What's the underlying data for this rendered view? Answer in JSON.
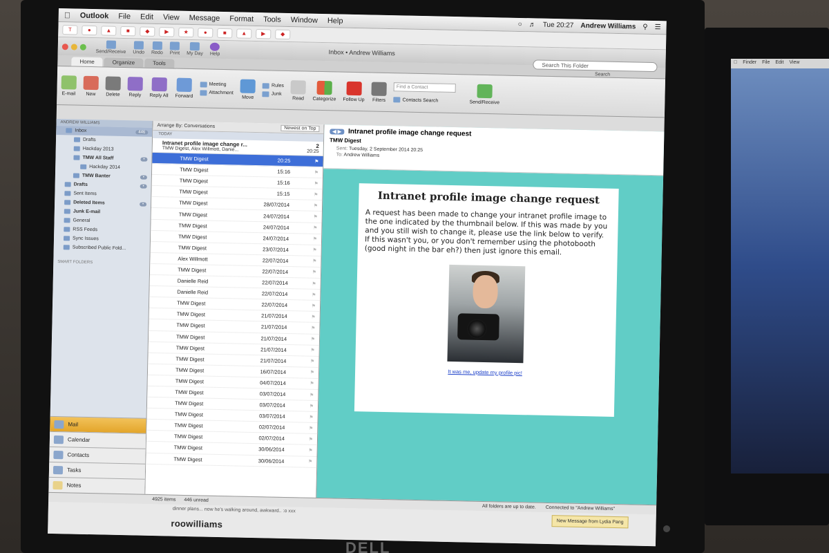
{
  "menubar": {
    "app_name": "Outlook",
    "menus": [
      "File",
      "Edit",
      "View",
      "Message",
      "Format",
      "Tools",
      "Window",
      "Help"
    ],
    "clock": "Tue 20:27",
    "user": "Andrew Williams"
  },
  "window": {
    "title": "Inbox • Andrew Williams",
    "quick_tools": [
      "Send/Receive",
      "Undo",
      "Redo",
      "Print",
      "My Day",
      "Help"
    ]
  },
  "tabs": [
    "Home",
    "Organize",
    "Tools"
  ],
  "search": {
    "placeholder": "Search This Folder",
    "caption": "Search"
  },
  "ribbon": {
    "buttons": [
      "E-mail",
      "New",
      "Delete",
      "Reply",
      "Reply All",
      "Forward"
    ],
    "small_buttons": [
      "Meeting",
      "Attachment"
    ],
    "move_label": "Move",
    "rules_label": "Rules",
    "junk_label": "Junk",
    "read_label": "Read",
    "categorize_label": "Categorize",
    "followup_label": "Follow Up",
    "filters_label": "Filters",
    "find_contact_placeholder": "Find a Contact",
    "contacts_search_label": "Contacts Search",
    "send_receive_label": "Send/Receive"
  },
  "sidebar": {
    "account": "ANDREW WILLIAMS",
    "folders": [
      {
        "label": "Inbox",
        "badge": "446",
        "level": 0,
        "selected": true
      },
      {
        "label": "Drafts",
        "badge": "",
        "level": 1,
        "selected": false
      },
      {
        "label": "Hackday 2013",
        "badge": "",
        "level": 1,
        "selected": false
      },
      {
        "label": "TMW All Staff",
        "badge": "",
        "level": 1,
        "selected": false
      },
      {
        "label": "Hackday 2014",
        "badge": "",
        "level": 2,
        "selected": false
      },
      {
        "label": "TMW Banter",
        "badge": "",
        "level": 1,
        "selected": false
      },
      {
        "label": "Drafts",
        "badge": "",
        "level": 0,
        "selected": false
      },
      {
        "label": "Sent Items",
        "badge": "",
        "level": 0,
        "selected": false
      },
      {
        "label": "Deleted Items",
        "badge": "",
        "level": 0,
        "selected": false
      },
      {
        "label": "Junk E-mail",
        "badge": "",
        "level": 0,
        "selected": false
      },
      {
        "label": "General",
        "badge": "",
        "level": 0,
        "selected": false
      },
      {
        "label": "RSS Feeds",
        "badge": "",
        "level": 0,
        "selected": false
      },
      {
        "label": "Sync Issues",
        "badge": "",
        "level": 0,
        "selected": false
      },
      {
        "label": "Subscribed Public Fold...",
        "badge": "",
        "level": 0,
        "selected": false
      }
    ],
    "smart_folders": "SMART FOLDERS",
    "nav": [
      {
        "label": "Mail",
        "selected": true
      },
      {
        "label": "Calendar",
        "selected": false
      },
      {
        "label": "Contacts",
        "selected": false
      },
      {
        "label": "Tasks",
        "selected": false
      },
      {
        "label": "Notes",
        "selected": false
      }
    ]
  },
  "message_list": {
    "arrange_by": "Arrange By: Conversations",
    "sort": "Newest on Top",
    "group": "TODAY",
    "conversation": {
      "subject": "Intranet profile image change r...",
      "count": "2",
      "participants": "TMW Digest, Alex Willmott, Danie...",
      "time": "20:25"
    },
    "rows": [
      {
        "from": "TMW Digest",
        "date": "20:25",
        "selected": true
      },
      {
        "from": "TMW Digest",
        "date": "15:16",
        "selected": false
      },
      {
        "from": "TMW Digest",
        "date": "15:16",
        "selected": false
      },
      {
        "from": "TMW Digest",
        "date": "15:15",
        "selected": false
      },
      {
        "from": "TMW Digest",
        "date": "28/07/2014",
        "selected": false
      },
      {
        "from": "TMW Digest",
        "date": "24/07/2014",
        "selected": false
      },
      {
        "from": "TMW Digest",
        "date": "24/07/2014",
        "selected": false
      },
      {
        "from": "TMW Digest",
        "date": "24/07/2014",
        "selected": false
      },
      {
        "from": "TMW Digest",
        "date": "23/07/2014",
        "selected": false
      },
      {
        "from": "Alex Willmott",
        "date": "22/07/2014",
        "selected": false
      },
      {
        "from": "TMW Digest",
        "date": "22/07/2014",
        "selected": false
      },
      {
        "from": "Danielle Reid",
        "date": "22/07/2014",
        "selected": false
      },
      {
        "from": "Danielle Reid",
        "date": "22/07/2014",
        "selected": false
      },
      {
        "from": "TMW Digest",
        "date": "22/07/2014",
        "selected": false
      },
      {
        "from": "TMW Digest",
        "date": "21/07/2014",
        "selected": false
      },
      {
        "from": "TMW Digest",
        "date": "21/07/2014",
        "selected": false
      },
      {
        "from": "TMW Digest",
        "date": "21/07/2014",
        "selected": false
      },
      {
        "from": "TMW Digest",
        "date": "21/07/2014",
        "selected": false
      },
      {
        "from": "TMW Digest",
        "date": "21/07/2014",
        "selected": false
      },
      {
        "from": "TMW Digest",
        "date": "16/07/2014",
        "selected": false
      },
      {
        "from": "TMW Digest",
        "date": "04/07/2014",
        "selected": false
      },
      {
        "from": "TMW Digest",
        "date": "03/07/2014",
        "selected": false
      },
      {
        "from": "TMW Digest",
        "date": "03/07/2014",
        "selected": false
      },
      {
        "from": "TMW Digest",
        "date": "03/07/2014",
        "selected": false
      },
      {
        "from": "TMW Digest",
        "date": "02/07/2014",
        "selected": false
      },
      {
        "from": "TMW Digest",
        "date": "02/07/2014",
        "selected": false
      },
      {
        "from": "TMW Digest",
        "date": "30/06/2014",
        "selected": false
      },
      {
        "from": "TMW Digest",
        "date": "30/06/2014",
        "selected": false
      }
    ]
  },
  "reading": {
    "subject": "Intranet profile image change request",
    "from": "TMW Digest",
    "sent_label": "Sent:",
    "sent": "Tuesday, 2 September 2014 20:25",
    "to_label": "To:",
    "to": "Andrew Williams",
    "card_title": "Intranet profile image change request",
    "body_1": "A request has been made to change your intranet profile image to the one indicated by the thumbnail below. If this was made by you and you still wish to change it, please use the link below to verify.",
    "body_2": "If this wasn't you, or you don't remember using the photobooth (good night in the bar eh?) then just ignore this email.",
    "link": "It was me, update my profile pic!"
  },
  "status": {
    "items": "4925 items",
    "unread": "446 unread",
    "sync": "All folders are up to date.",
    "connection": "Connected to \"Andrew Williams\""
  },
  "below": {
    "snippet": "dinner plans... now he's walking around, awkward.. :o xxx",
    "brand": "roowilliams",
    "notification": "New Message from Lydia Pang"
  },
  "second_monitor": {
    "menus": [
      "Finder",
      "File",
      "Edit",
      "View"
    ]
  },
  "colors": {
    "selection": "#3d6ed8",
    "reading_bg": "#61cdc6",
    "mail_nav": "#e3a52a"
  }
}
